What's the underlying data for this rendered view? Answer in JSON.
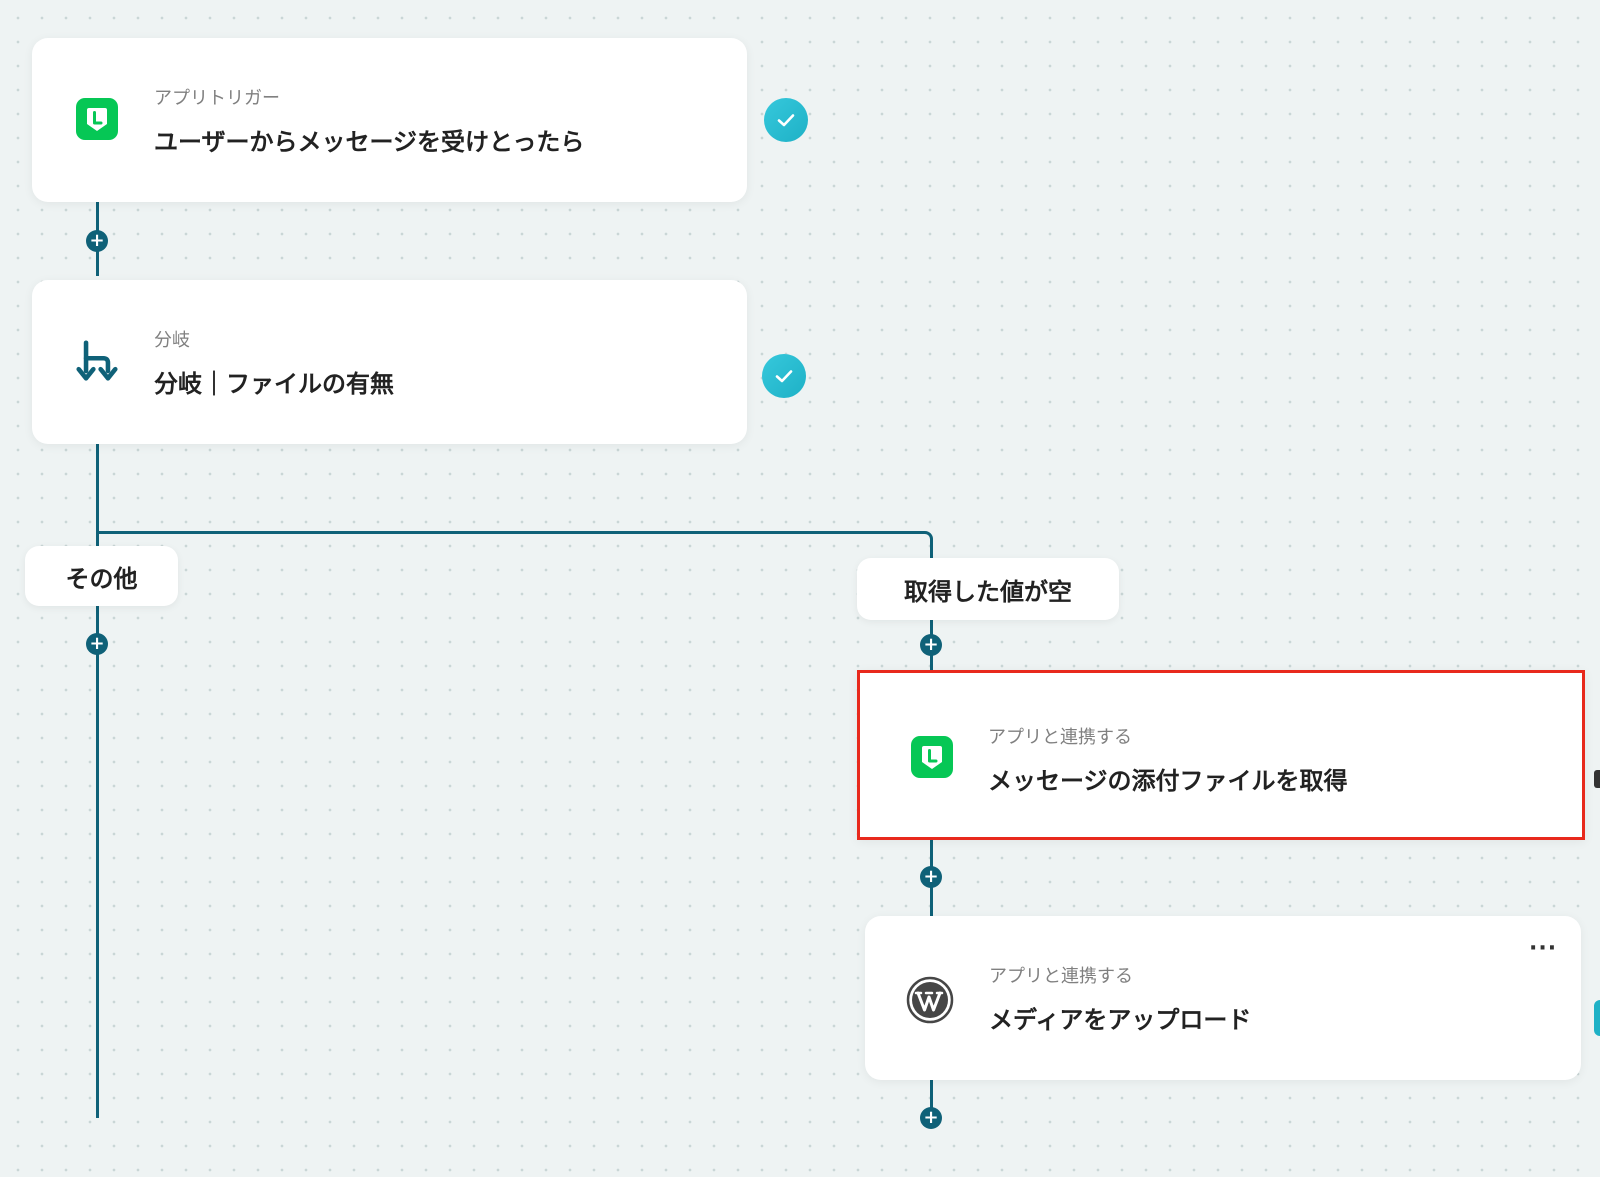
{
  "colors": {
    "connector": "#0f6178",
    "check": "#1eb1c6",
    "line_app": "#06c755",
    "selection_border": "#e8291c",
    "wordpress": "#464646"
  },
  "steps": [
    {
      "subtitle": "アプリトリガー",
      "title": "ユーザーからメッセージを受けとったら",
      "icon": "line-app-icon",
      "status": "check-icon"
    },
    {
      "subtitle": "分岐",
      "title": "分岐｜ファイルの有無",
      "icon": "branch-icon",
      "status": "check-icon"
    }
  ],
  "branches": {
    "left_label": "その他",
    "right_label": "取得した値が空"
  },
  "branch_steps": [
    {
      "subtitle": "アプリと連携する",
      "title": "メッセージの添付ファイルを取得",
      "icon": "line-app-icon",
      "selected": true
    },
    {
      "subtitle": "アプリと連携する",
      "title": "メディアをアップロード",
      "icon": "wordpress-icon",
      "menu": "more-options-icon"
    }
  ],
  "menu_label": "···"
}
